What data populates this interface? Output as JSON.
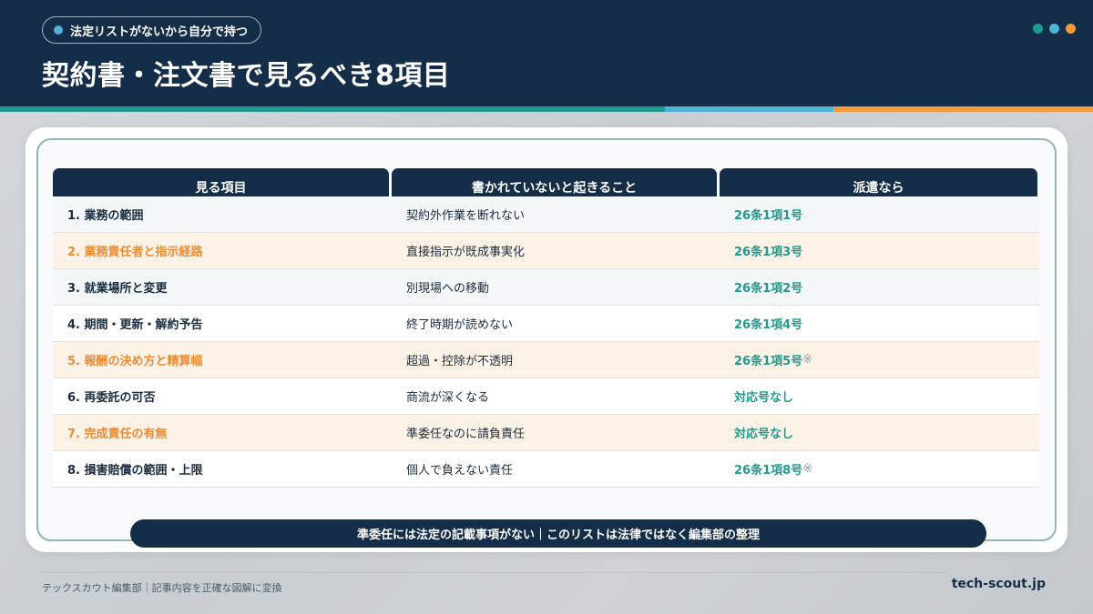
{
  "header": {
    "tag": "法定リストがないから自分で持つ",
    "title": "契約書・注文書で見るべき8項目"
  },
  "colors": {
    "navy": "#142d48",
    "teal": "#1e9a8e",
    "sky": "#4fb3d6",
    "orange": "#f39a3b",
    "highlight_text": "#ef8c32",
    "highlight_row": "#fdf2e6"
  },
  "table": {
    "headers": [
      "見る項目",
      "書かれていないと起きること",
      "派遣なら"
    ],
    "rows": [
      {
        "item": "1. 業務の範囲",
        "consequence": "契約外作業を断れない",
        "dispatch": "26条1項1号",
        "mark": "",
        "highlight": false
      },
      {
        "item": "2. 業務責任者と指示経路",
        "consequence": "直接指示が既成事実化",
        "dispatch": "26条1項3号",
        "mark": "",
        "highlight": true
      },
      {
        "item": "3. 就業場所と変更",
        "consequence": "別現場への移動",
        "dispatch": "26条1項2号",
        "mark": "",
        "highlight": false
      },
      {
        "item": "4. 期間・更新・解約予告",
        "consequence": "終了時期が読めない",
        "dispatch": "26条1項4号",
        "mark": "",
        "highlight": false
      },
      {
        "item": "5. 報酬の決め方と精算幅",
        "consequence": "超過・控除が不透明",
        "dispatch": "26条1項5号",
        "mark": "※",
        "highlight": true
      },
      {
        "item": "6. 再委託の可否",
        "consequence": "商流が深くなる",
        "dispatch": "対応号なし",
        "mark": "",
        "highlight": false
      },
      {
        "item": "7. 完成責任の有無",
        "consequence": "準委任なのに請負責任",
        "dispatch": "対応号なし",
        "mark": "",
        "highlight": true
      },
      {
        "item": "8. 損害賠償の範囲・上限",
        "consequence": "個人で負えない責任",
        "dispatch": "26条1項8号",
        "mark": "※",
        "highlight": false
      }
    ]
  },
  "note": "準委任には法定の記載事項がない｜このリストは法律ではなく編集部の整理",
  "footer": {
    "left": "テックスカウト編集部｜記事内容を正確な図解に変換",
    "right": "tech-scout.jp"
  }
}
